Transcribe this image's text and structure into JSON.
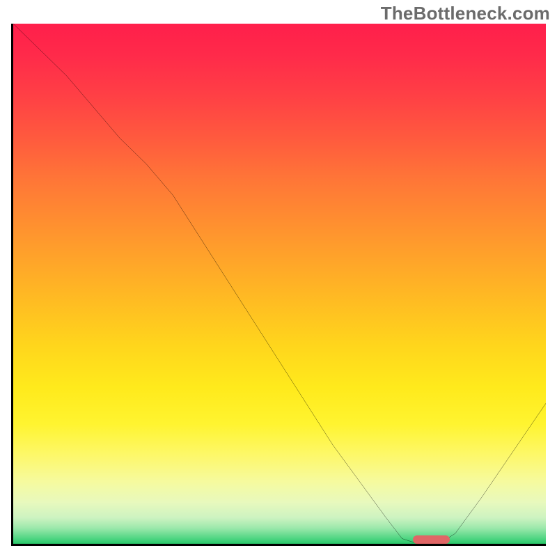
{
  "watermark": {
    "text": "TheBottleneck.com"
  },
  "chart_data": {
    "type": "line",
    "title": "",
    "xlabel": "",
    "ylabel": "",
    "x_range": [
      0,
      100
    ],
    "y_range": [
      0,
      100
    ],
    "grid": false,
    "legend": false,
    "background": {
      "kind": "vertical-gradient",
      "mapping": "top = high bottleneck, bottom = low bottleneck",
      "stops": [
        {
          "pos": 0,
          "color": "#ff1f4b"
        },
        {
          "pos": 50,
          "color": "#ffbe22"
        },
        {
          "pos": 80,
          "color": "#fdf86a"
        },
        {
          "pos": 100,
          "color": "#2ac96a"
        }
      ]
    },
    "series": [
      {
        "name": "bottleneck-curve",
        "x": [
          0,
          5,
          10,
          15,
          20,
          25,
          30,
          35,
          40,
          45,
          50,
          55,
          60,
          65,
          70,
          73,
          76,
          80,
          83,
          88,
          94,
          100
        ],
        "y": [
          100,
          95,
          90,
          84,
          78,
          73,
          67,
          59,
          51,
          43,
          35,
          27,
          19,
          12,
          5,
          1,
          0,
          0,
          2,
          9,
          18,
          27
        ]
      }
    ],
    "marker": {
      "name": "optimal-range",
      "x_start": 75,
      "x_end": 82,
      "y": 0,
      "color": "#e06666"
    }
  }
}
